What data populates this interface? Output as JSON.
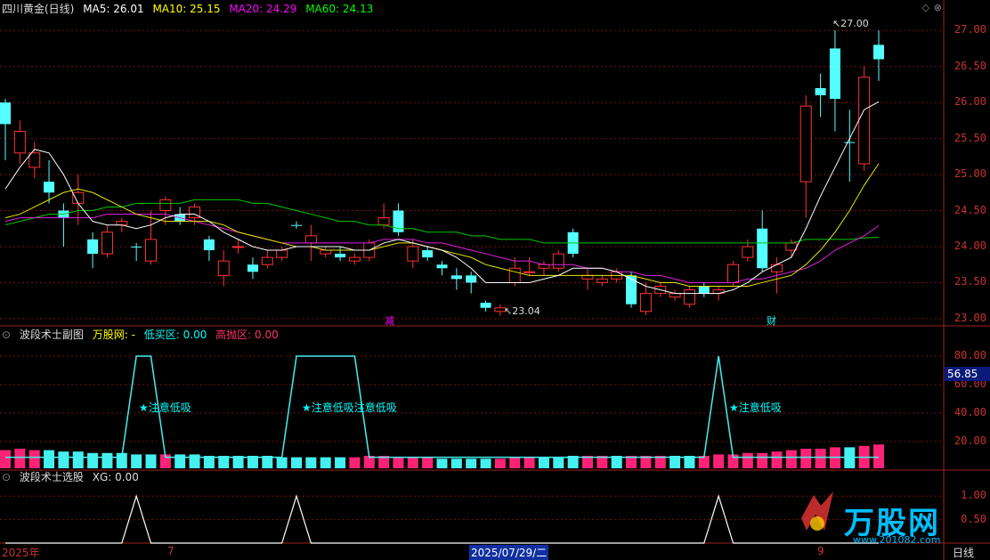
{
  "main_panel": {
    "title": "四川黄金(日线)",
    "ma": [
      {
        "label": "MA5: 26.01",
        "color": "#ffffff"
      },
      {
        "label": "MA10: 25.15",
        "color": "#ffff00"
      },
      {
        "label": "MA20: 24.29",
        "color": "#ff00ff"
      },
      {
        "label": "MA60: 24.13",
        "color": "#00ff00"
      }
    ],
    "y_ticks": [
      "27.00",
      "26.50",
      "26.00",
      "25.50",
      "25.00",
      "24.50",
      "24.00",
      "23.50",
      "23.00"
    ],
    "high_marker": "27.00",
    "low_marker": "23.04",
    "event_markers": [
      "减",
      "财"
    ]
  },
  "sub_panel1": {
    "title": "波段术士副图",
    "labels": [
      {
        "text": "万股网: -",
        "color": "#ffff00"
      },
      {
        "text": "低买区: 0.00",
        "color": "#00ffff"
      },
      {
        "text": "高抛区: 0.00",
        "color": "#ff3366"
      }
    ],
    "y_ticks": [
      "80.00",
      "60.00",
      "40.00",
      "20.00"
    ],
    "current_tag": "56.85",
    "annotations": [
      "★注意低吸",
      "★注意低吸注意低吸",
      "★注意低吸"
    ]
  },
  "sub_panel2": {
    "title": "波段术士选股",
    "labels": [
      {
        "text": "XG: 0.00",
        "color": "#dddddd"
      }
    ],
    "y_ticks": [
      "1.00",
      "0.50"
    ]
  },
  "date_bar": {
    "start": "2025年",
    "mark": "7",
    "cursor_date": "2025/07/29/二",
    "end_mark": "9",
    "period": "日线"
  },
  "watermark": {
    "logo_text": "万股网",
    "url": "www.201082.com"
  },
  "chart_data": {
    "type": "candlestick",
    "title": "四川黄金(日线)",
    "ylim": [
      22.9,
      27.2
    ],
    "candles": [
      {
        "o": 25.7,
        "c": 26.0,
        "h": 26.05,
        "l": 25.2,
        "up": false
      },
      {
        "o": 25.3,
        "c": 25.6,
        "h": 25.75,
        "l": 25.15,
        "up": true
      },
      {
        "o": 25.1,
        "c": 25.3,
        "h": 25.45,
        "l": 24.95,
        "up": true
      },
      {
        "o": 24.9,
        "c": 24.75,
        "h": 25.2,
        "l": 24.6,
        "up": false
      },
      {
        "o": 24.4,
        "c": 24.5,
        "h": 24.6,
        "l": 24.0,
        "up": false
      },
      {
        "o": 24.6,
        "c": 24.75,
        "h": 25.0,
        "l": 24.3,
        "up": true
      },
      {
        "o": 24.1,
        "c": 23.9,
        "h": 24.2,
        "l": 23.7,
        "up": false
      },
      {
        "o": 23.9,
        "c": 24.2,
        "h": 24.3,
        "l": 23.85,
        "up": true
      },
      {
        "o": 24.3,
        "c": 24.35,
        "h": 24.4,
        "l": 24.2,
        "up": true
      },
      {
        "o": 24.0,
        "c": 24.0,
        "h": 24.05,
        "l": 23.8,
        "up": false
      },
      {
        "o": 23.8,
        "c": 24.1,
        "h": 24.5,
        "l": 23.75,
        "up": true
      },
      {
        "o": 24.5,
        "c": 24.65,
        "h": 24.7,
        "l": 24.3,
        "up": true
      },
      {
        "o": 24.45,
        "c": 24.35,
        "h": 24.55,
        "l": 24.3,
        "up": false
      },
      {
        "o": 24.4,
        "c": 24.55,
        "h": 24.6,
        "l": 24.3,
        "up": true
      },
      {
        "o": 24.1,
        "c": 23.95,
        "h": 24.15,
        "l": 23.8,
        "up": false
      },
      {
        "o": 23.6,
        "c": 23.8,
        "h": 23.95,
        "l": 23.45,
        "up": true
      },
      {
        "o": 24.0,
        "c": 24.0,
        "h": 24.1,
        "l": 23.9,
        "up": true
      },
      {
        "o": 23.75,
        "c": 23.65,
        "h": 23.85,
        "l": 23.55,
        "up": false
      },
      {
        "o": 23.75,
        "c": 23.85,
        "h": 23.95,
        "l": 23.7,
        "up": true
      },
      {
        "o": 23.85,
        "c": 23.95,
        "h": 24.0,
        "l": 23.8,
        "up": true
      },
      {
        "o": 24.3,
        "c": 24.3,
        "h": 24.35,
        "l": 24.25,
        "up": false
      },
      {
        "o": 24.05,
        "c": 24.15,
        "h": 24.3,
        "l": 23.8,
        "up": true
      },
      {
        "o": 23.9,
        "c": 23.95,
        "h": 24.0,
        "l": 23.85,
        "up": true
      },
      {
        "o": 23.9,
        "c": 23.85,
        "h": 24.0,
        "l": 23.8,
        "up": false
      },
      {
        "o": 23.8,
        "c": 23.85,
        "h": 23.9,
        "l": 23.75,
        "up": true
      },
      {
        "o": 23.85,
        "c": 24.05,
        "h": 24.1,
        "l": 23.8,
        "up": true
      },
      {
        "o": 24.3,
        "c": 24.4,
        "h": 24.6,
        "l": 24.25,
        "up": true
      },
      {
        "o": 24.5,
        "c": 24.2,
        "h": 24.6,
        "l": 24.15,
        "up": false
      },
      {
        "o": 23.8,
        "c": 24.0,
        "h": 24.1,
        "l": 23.7,
        "up": true
      },
      {
        "o": 23.95,
        "c": 23.85,
        "h": 24.0,
        "l": 23.8,
        "up": false
      },
      {
        "o": 23.75,
        "c": 23.7,
        "h": 23.8,
        "l": 23.6,
        "up": false
      },
      {
        "o": 23.6,
        "c": 23.55,
        "h": 23.7,
        "l": 23.4,
        "up": false
      },
      {
        "o": 23.6,
        "c": 23.5,
        "h": 23.65,
        "l": 23.35,
        "up": false
      },
      {
        "o": 23.22,
        "c": 23.15,
        "h": 23.25,
        "l": 23.1,
        "up": false
      },
      {
        "o": 23.1,
        "c": 23.15,
        "h": 23.2,
        "l": 23.04,
        "up": true
      },
      {
        "o": 23.5,
        "c": 23.7,
        "h": 23.85,
        "l": 23.45,
        "up": true
      },
      {
        "o": 23.65,
        "c": 23.65,
        "h": 23.85,
        "l": 23.6,
        "up": true
      },
      {
        "o": 23.7,
        "c": 23.75,
        "h": 23.8,
        "l": 23.6,
        "up": true
      },
      {
        "o": 23.7,
        "c": 23.9,
        "h": 23.95,
        "l": 23.65,
        "up": true
      },
      {
        "o": 24.2,
        "c": 23.9,
        "h": 24.25,
        "l": 23.85,
        "up": false
      },
      {
        "o": 23.55,
        "c": 23.6,
        "h": 23.7,
        "l": 23.4,
        "up": true
      },
      {
        "o": 23.5,
        "c": 23.55,
        "h": 23.6,
        "l": 23.45,
        "up": true
      },
      {
        "o": 23.55,
        "c": 23.65,
        "h": 23.7,
        "l": 23.5,
        "up": true
      },
      {
        "o": 23.6,
        "c": 23.2,
        "h": 23.65,
        "l": 23.15,
        "up": false
      },
      {
        "o": 23.1,
        "c": 23.35,
        "h": 23.5,
        "l": 23.05,
        "up": true
      },
      {
        "o": 23.35,
        "c": 23.45,
        "h": 23.5,
        "l": 23.3,
        "up": true
      },
      {
        "o": 23.3,
        "c": 23.35,
        "h": 23.4,
        "l": 23.25,
        "up": true
      },
      {
        "o": 23.2,
        "c": 23.4,
        "h": 23.45,
        "l": 23.15,
        "up": true
      },
      {
        "o": 23.45,
        "c": 23.35,
        "h": 23.5,
        "l": 23.3,
        "up": false
      },
      {
        "o": 23.35,
        "c": 23.4,
        "h": 23.45,
        "l": 23.25,
        "up": true
      },
      {
        "o": 23.5,
        "c": 23.75,
        "h": 23.8,
        "l": 23.45,
        "up": true
      },
      {
        "o": 23.85,
        "c": 24.0,
        "h": 24.1,
        "l": 23.8,
        "up": true
      },
      {
        "o": 24.25,
        "c": 23.7,
        "h": 24.5,
        "l": 23.65,
        "up": false
      },
      {
        "o": 23.65,
        "c": 23.75,
        "h": 23.85,
        "l": 23.35,
        "up": true
      },
      {
        "o": 23.95,
        "c": 24.05,
        "h": 24.1,
        "l": 23.85,
        "up": true
      },
      {
        "o": 24.9,
        "c": 25.95,
        "h": 26.1,
        "l": 24.4,
        "up": true
      },
      {
        "o": 26.1,
        "c": 26.2,
        "h": 26.4,
        "l": 25.8,
        "up": false
      },
      {
        "o": 26.75,
        "c": 26.05,
        "h": 27.0,
        "l": 25.6,
        "up": false
      },
      {
        "o": 25.45,
        "c": 25.45,
        "h": 25.9,
        "l": 24.9,
        "up": false
      },
      {
        "o": 25.15,
        "c": 26.35,
        "h": 26.5,
        "l": 25.05,
        "up": true
      },
      {
        "o": 26.6,
        "c": 26.8,
        "h": 27.0,
        "l": 26.3,
        "up": false
      }
    ],
    "ma5": [
      24.8,
      25.1,
      25.35,
      25.3,
      25.0,
      24.6,
      24.35,
      24.3,
      24.3,
      24.25,
      24.3,
      24.4,
      24.45,
      24.45,
      24.35,
      24.2,
      24.1,
      24.0,
      23.95,
      23.95,
      24.0,
      24.0,
      24.0,
      24.0,
      23.95,
      23.95,
      24.05,
      24.1,
      24.05,
      24.0,
      23.95,
      23.85,
      23.7,
      23.5,
      23.5,
      23.5,
      23.5,
      23.55,
      23.6,
      23.7,
      23.7,
      23.7,
      23.65,
      23.55,
      23.45,
      23.4,
      23.35,
      23.35,
      23.35,
      23.35,
      23.4,
      23.5,
      23.65,
      23.75,
      23.85,
      24.25,
      24.7,
      25.1,
      25.5,
      25.9,
      26.01
    ],
    "ma10": [
      24.4,
      24.45,
      24.55,
      24.65,
      24.75,
      24.8,
      24.75,
      24.65,
      24.55,
      24.45,
      24.4,
      24.35,
      24.35,
      24.35,
      24.35,
      24.3,
      24.2,
      24.15,
      24.1,
      24.05,
      24.0,
      24.0,
      23.95,
      23.95,
      23.95,
      23.95,
      24.0,
      24.05,
      24.05,
      24.0,
      23.95,
      23.9,
      23.85,
      23.75,
      23.7,
      23.65,
      23.6,
      23.6,
      23.6,
      23.6,
      23.6,
      23.6,
      23.6,
      23.6,
      23.55,
      23.5,
      23.5,
      23.45,
      23.45,
      23.45,
      23.45,
      23.45,
      23.5,
      23.55,
      23.6,
      23.75,
      23.95,
      24.2,
      24.5,
      24.85,
      25.15
    ],
    "ma20": [
      24.35,
      24.4,
      24.4,
      24.4,
      24.4,
      24.4,
      24.4,
      24.45,
      24.45,
      24.45,
      24.45,
      24.45,
      24.4,
      24.35,
      24.3,
      24.25,
      24.2,
      24.15,
      24.1,
      24.05,
      24.05,
      24.05,
      24.05,
      24.05,
      24.05,
      24.05,
      24.1,
      24.1,
      24.1,
      24.05,
      24.05,
      24.0,
      23.95,
      23.9,
      23.85,
      23.8,
      23.8,
      23.75,
      23.75,
      23.75,
      23.7,
      23.7,
      23.65,
      23.65,
      23.6,
      23.6,
      23.55,
      23.5,
      23.5,
      23.5,
      23.5,
      23.55,
      23.55,
      23.6,
      23.65,
      23.7,
      23.8,
      23.95,
      24.05,
      24.15,
      24.29
    ],
    "ma60": [
      24.3,
      24.35,
      24.4,
      24.45,
      24.45,
      24.5,
      24.5,
      24.55,
      24.55,
      24.6,
      24.6,
      24.6,
      24.6,
      24.65,
      24.65,
      24.65,
      24.65,
      24.6,
      24.6,
      24.55,
      24.5,
      24.45,
      24.4,
      24.35,
      24.35,
      24.3,
      24.3,
      24.25,
      24.25,
      24.2,
      24.2,
      24.2,
      24.15,
      24.15,
      24.1,
      24.1,
      24.1,
      24.05,
      24.05,
      24.05,
      24.05,
      24.05,
      24.05,
      24.05,
      24.05,
      24.05,
      24.05,
      24.05,
      24.05,
      24.05,
      24.05,
      24.05,
      24.05,
      24.05,
      24.05,
      24.1,
      24.1,
      24.1,
      24.1,
      24.12,
      24.13
    ],
    "sub1_line": [
      0,
      0,
      0,
      0,
      0,
      0,
      0,
      0,
      0,
      80,
      80,
      0,
      0,
      0,
      0,
      0,
      0,
      0,
      0,
      0,
      80,
      80,
      80,
      80,
      80,
      0,
      0,
      0,
      0,
      0,
      0,
      0,
      0,
      0,
      0,
      0,
      0,
      0,
      0,
      0,
      0,
      0,
      0,
      0,
      0,
      0,
      0,
      0,
      0,
      80,
      0,
      0,
      0,
      0,
      0,
      0,
      0,
      0,
      0,
      0,
      0
    ],
    "sub1_bars": [
      14,
      15,
      14,
      14,
      13,
      13,
      12,
      12,
      12,
      11,
      11,
      11,
      11,
      11,
      10,
      10,
      10,
      10,
      10,
      9,
      9,
      9,
      9,
      9,
      9,
      10,
      10,
      9,
      9,
      9,
      8,
      8,
      8,
      8,
      8,
      9,
      9,
      9,
      9,
      10,
      10,
      10,
      10,
      10,
      10,
      10,
      10,
      10,
      10,
      11,
      11,
      12,
      12,
      13,
      14,
      15,
      15,
      16,
      16,
      17,
      18
    ],
    "sub1_bar_colors": [
      "p",
      "p",
      "p",
      "c",
      "c",
      "c",
      "c",
      "c",
      "c",
      "c",
      "c",
      "p",
      "c",
      "c",
      "c",
      "c",
      "c",
      "c",
      "c",
      "c",
      "c",
      "c",
      "c",
      "c",
      "p",
      "p",
      "p",
      "p",
      "p",
      "p",
      "c",
      "c",
      "c",
      "c",
      "p",
      "p",
      "p",
      "c",
      "c",
      "c",
      "p",
      "p",
      "c",
      "p",
      "p",
      "p",
      "c",
      "c",
      "p",
      "p",
      "p",
      "p",
      "p",
      "p",
      "p",
      "p",
      "p",
      "p",
      "c",
      "p",
      "p"
    ],
    "sub2_line": [
      0,
      0,
      0,
      0,
      0,
      0,
      0,
      0,
      0,
      1,
      0,
      0,
      0,
      0,
      0,
      0,
      0,
      0,
      0,
      0,
      1,
      0,
      0,
      0,
      0,
      0,
      0,
      0,
      0,
      0,
      0,
      0,
      0,
      0,
      0,
      0,
      0,
      0,
      0,
      0,
      0,
      0,
      0,
      0,
      0,
      0,
      0,
      0,
      0,
      1,
      0,
      0,
      0,
      0,
      0,
      0,
      0,
      0,
      0,
      0,
      0
    ]
  }
}
